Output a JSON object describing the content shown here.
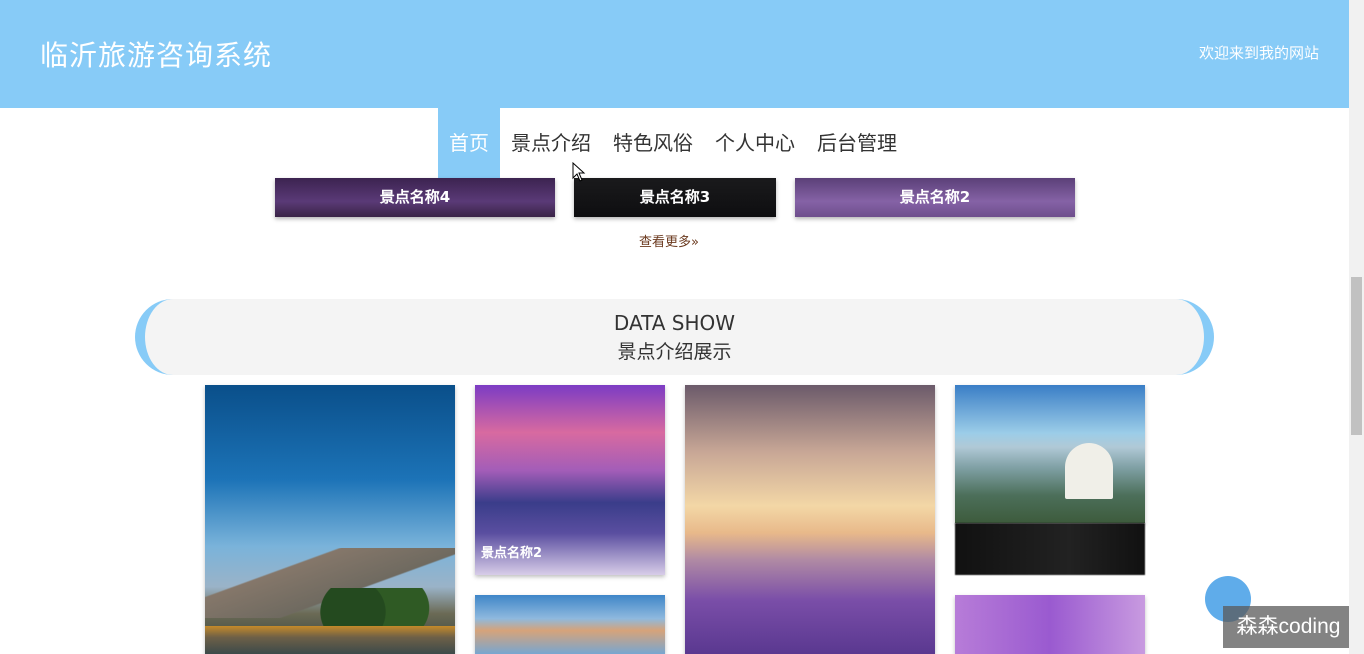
{
  "header": {
    "site_title": "临沂旅游咨询系统",
    "welcome_text": "欢迎来到我的网站"
  },
  "nav": {
    "items": [
      {
        "label": "首页",
        "active": true
      },
      {
        "label": "景点介绍",
        "active": false
      },
      {
        "label": "特色风俗",
        "active": false
      },
      {
        "label": "个人中心",
        "active": false
      },
      {
        "label": "后台管理",
        "active": false
      }
    ]
  },
  "featured_cards": [
    {
      "label": "景点名称4"
    },
    {
      "label": "景点名称3"
    },
    {
      "label": "景点名称2"
    }
  ],
  "more_link": {
    "label": "查看更多",
    "icon": "double-chevron-right-icon"
  },
  "data_show": {
    "title_en": "DATA SHOW",
    "title_cn": "景点介绍展示"
  },
  "gallery": {
    "caption_2": "景点名称2"
  },
  "watermark": {
    "text": "森森coding"
  },
  "colors": {
    "accent": "#87cbf7",
    "link_brown": "#6b3a1f",
    "banner_bg": "#f4f4f4"
  }
}
